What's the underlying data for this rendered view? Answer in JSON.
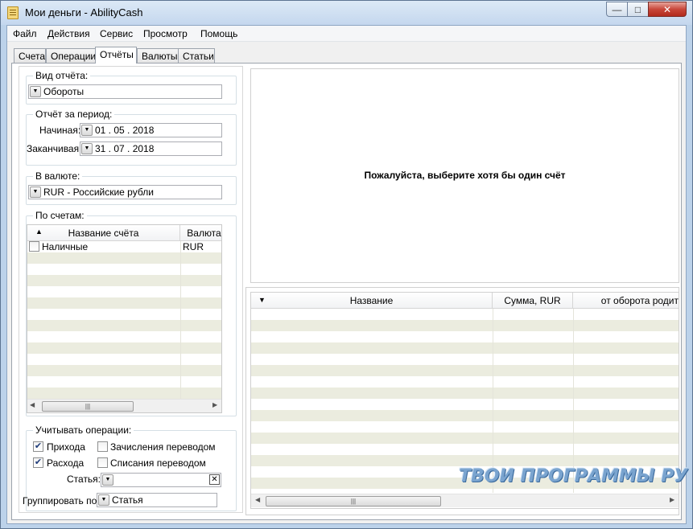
{
  "window": {
    "title": "Мои деньги - AbilityCash"
  },
  "menu": [
    "Файл",
    "Действия",
    "Сервис",
    "Просмотр",
    "Помощь"
  ],
  "tabs": [
    "Счета",
    "Операции",
    "Отчёты",
    "Валюты",
    "Статьи"
  ],
  "active_tab": "Отчёты",
  "report_type": {
    "label": "Вид отчёта:",
    "value": "Обороты"
  },
  "period": {
    "label": "Отчёт за период:",
    "start_label": "Начиная:",
    "start_value": "01 . 05 . 2018",
    "end_label": "Заканчивая:",
    "end_value": "31 . 07 . 2018"
  },
  "currency": {
    "label": "В валюте:",
    "value": "RUR - Российские рубли"
  },
  "accounts": {
    "label": "По счетам:",
    "columns": [
      "Название счёта",
      "Валюта"
    ],
    "rows": [
      {
        "name": "Наличные",
        "currency": "RUR",
        "checked": false
      }
    ]
  },
  "operations": {
    "label": "Учитывать операции:",
    "income": "Прихода",
    "income_checked": true,
    "expense": "Расхода",
    "expense_checked": true,
    "transfer_in": "Зачисления переводом",
    "transfer_in_checked": false,
    "transfer_out": "Списания переводом",
    "transfer_out_checked": false,
    "article_label": "Статья:",
    "article_value": ""
  },
  "group_by": {
    "label": "Группировать по:",
    "value": "Статья"
  },
  "report_message": "Пожалуйста, выберите хотя бы один счёт",
  "result_table": {
    "columns": [
      "Название",
      "Сумма, RUR",
      "от оборота родит"
    ]
  },
  "watermark": "ТВОИ ПРОГРАММЫ РУ"
}
